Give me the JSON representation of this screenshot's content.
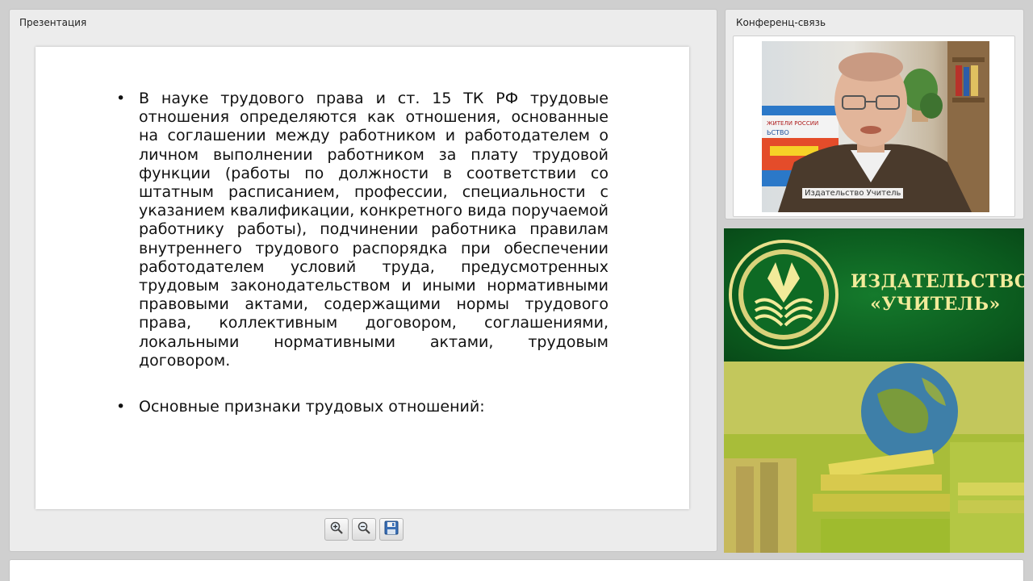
{
  "presentation": {
    "panel_title": "Презентация",
    "bullets": [
      "В науке трудового права и ст. 15 ТК РФ трудовые отношения определяются как отношения, основанные на соглашении между работником и работодателем о личном выполнении работником за плату трудовой функции (работы по должности в соответствии со штатным расписанием, профессии, специальности с указанием квалификации, конкретного вида поручаемой работнику работы), подчинении работника правилам внутреннего трудового распорядка при обеспечении работодателем условий труда, предусмотренных трудовым законодательством и иными нормативными правовыми актами, содержащими нормы трудового права, коллективным договором, соглашениями, локальными нормативными актами, трудовым договором.",
      "Основные признаки трудовых отношений:"
    ],
    "bullet_symbol": "•",
    "toolbar": {
      "zoom_in_icon": "zoom-in-icon",
      "zoom_out_icon": "zoom-out-icon",
      "save_icon": "floppy-disk-icon"
    }
  },
  "conference": {
    "panel_title": "Конференц-связь",
    "video_label": "Издательство Учитель",
    "video_sign_lines": [
      "ЖИТЕЛИ РОССИИ",
      "ЬСТВО"
    ]
  },
  "banner": {
    "line1": "ИЗДАТЕЛЬСТВО",
    "line2": "«УЧИТЕЛЬ»",
    "colors": {
      "green": "#0b5a1e",
      "gold": "#f2eb9a"
    }
  }
}
